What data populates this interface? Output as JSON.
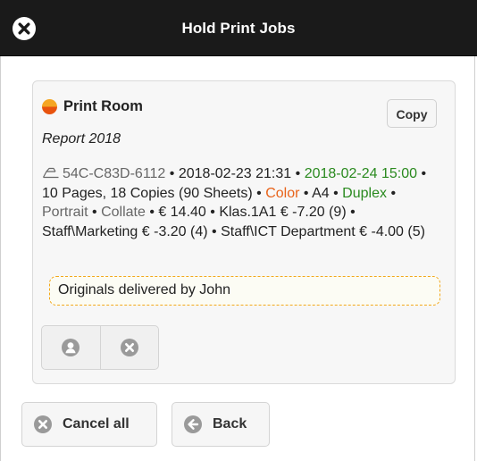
{
  "header": {
    "title": "Hold Print Jobs",
    "close_icon": "close-icon"
  },
  "job": {
    "printer_name": "Print Room",
    "printer_status_colors": [
      "#f5a623",
      "#e8530e"
    ],
    "copy_label": "Copy",
    "document_name": "Report 2018",
    "printer_icon": "printer-icon",
    "printer_id": "54C-C83D-6112",
    "submitted": "2018-02-23 21:31",
    "expires": "2018-02-24 15:00",
    "pages_copies": "10 Pages, 18 Copies (90 Sheets)",
    "color_mode": "Color",
    "paper_size": "A4",
    "duplex": "Duplex",
    "orientation": "Portrait",
    "collate": "Collate",
    "cost": "€ 14.40",
    "account_1": "Klas.1A1",
    "account_1_cost": "€ -7.20 (9)",
    "account_2": "Staff\\Marketing",
    "account_2_cost": "€ -3.20 (4)",
    "account_3": "Staff\\ICT Department",
    "account_3_cost": "€ -4.00 (5)",
    "separator": "•",
    "comment": "Originals delivered by John",
    "actions": [
      {
        "icon": "user-icon"
      },
      {
        "icon": "cancel-icon"
      }
    ]
  },
  "footer": {
    "cancel_all_label": "Cancel all",
    "back_label": "Back"
  },
  "colors": {
    "header_bg": "#1a1a1a",
    "accent_green": "#2a8a1f",
    "accent_orange": "#e8631a",
    "muted_gray": "#666666",
    "comment_border": "#f3a81a"
  }
}
